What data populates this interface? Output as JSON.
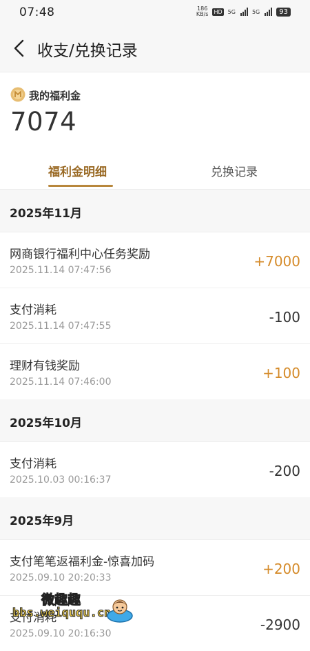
{
  "status_bar": {
    "time": "07:48",
    "speed": "186",
    "speed_unit": "KB/s",
    "hd": "HD",
    "net1": "5G",
    "net2": "5G",
    "battery": "93"
  },
  "header": {
    "title": "收支/兑换记录"
  },
  "balance": {
    "label": "我的福利金",
    "value": "7074"
  },
  "tabs": [
    {
      "label": "福利金明细",
      "active": true
    },
    {
      "label": "兑换记录",
      "active": false
    }
  ],
  "months": [
    "2025年11月",
    "2025年10月",
    "2025年9月"
  ],
  "records": [
    {
      "title": "网商银行福利中心任务奖励",
      "time": "2025.11.14 07:47:56",
      "amount": "+7000",
      "sign": "plus"
    },
    {
      "title": "支付消耗",
      "time": "2025.11.14 07:47:55",
      "amount": "-100",
      "sign": "minus"
    },
    {
      "title": "理财有钱奖励",
      "time": "2025.11.14 07:46:00",
      "amount": "+100",
      "sign": "plus"
    },
    {
      "title": "支付消耗",
      "time": "2025.10.03 00:16:37",
      "amount": "-200",
      "sign": "minus"
    },
    {
      "title": "支付笔笔返福利金-惊喜加码",
      "time": "2025.09.10 20:20:33",
      "amount": "+200",
      "sign": "plus"
    },
    {
      "title": "支付消耗",
      "time": "2025.09.10 20:16:30",
      "amount": "-2900",
      "sign": "minus"
    }
  ],
  "watermark": {
    "line1": "微趣趣",
    "line2": "bbs.weiququ.cn"
  },
  "colors": {
    "accent": "#b8873c",
    "plus": "#d58b2a",
    "background": "#f7f7f7"
  }
}
